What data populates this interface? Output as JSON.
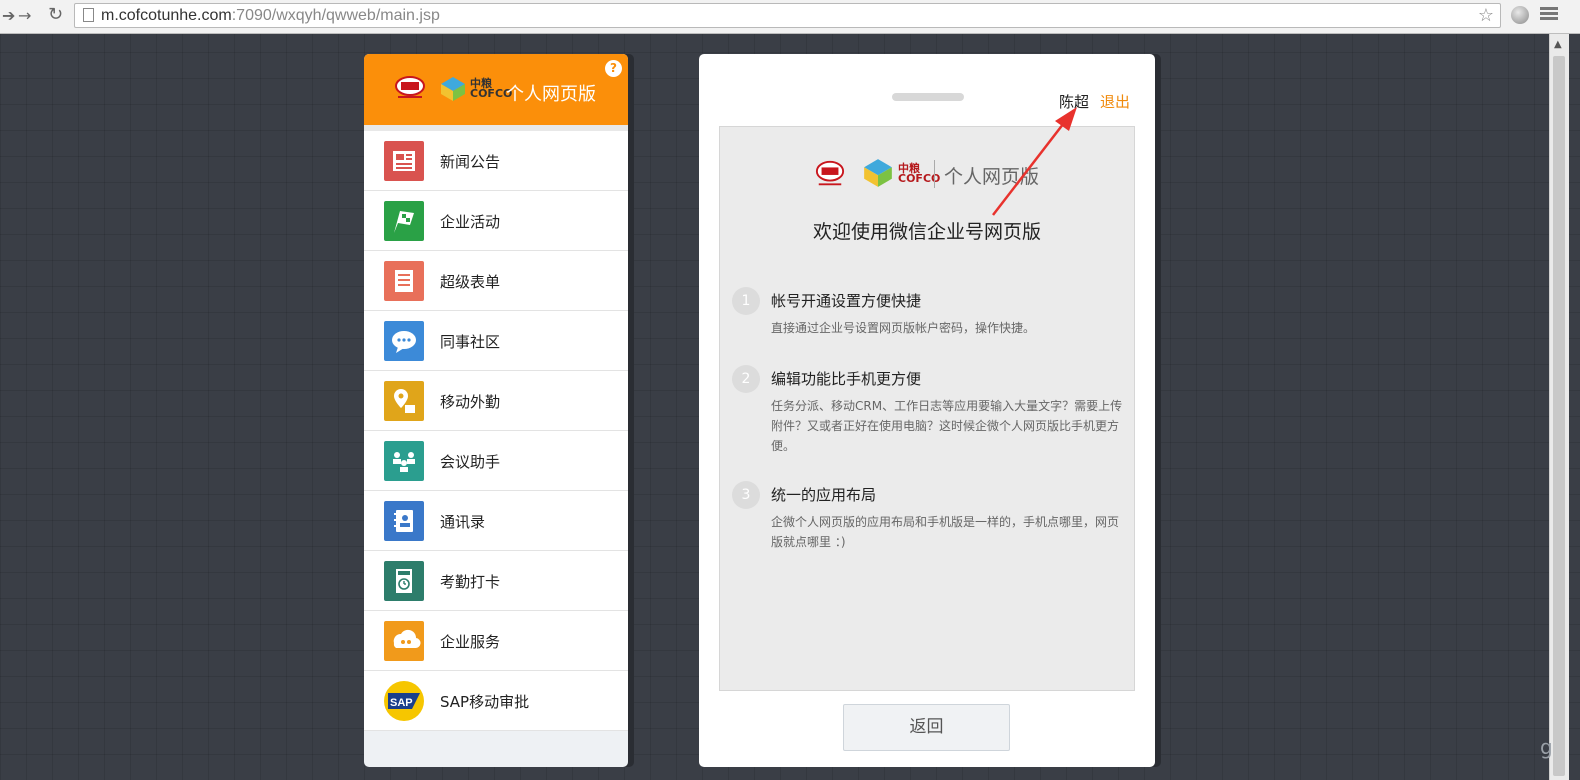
{
  "browser": {
    "url_host": "m.cofcotunhe.com",
    "url_path": ":7090/wxqyh/qwweb/main.jsp"
  },
  "left_panel": {
    "title": "个人网页版",
    "help": "?",
    "menu": [
      {
        "label": "新闻公告",
        "icon": "news-icon",
        "color": "#d9534f"
      },
      {
        "label": "企业活动",
        "icon": "flag-icon",
        "color": "#2aa146"
      },
      {
        "label": "超级表单",
        "icon": "form-icon",
        "color": "#e8705a"
      },
      {
        "label": "同事社区",
        "icon": "chat-icon",
        "color": "#3c8ad8"
      },
      {
        "label": "移动外勤",
        "icon": "location-icon",
        "color": "#e0a51a"
      },
      {
        "label": "会议助手",
        "icon": "meeting-icon",
        "color": "#2b9e8f"
      },
      {
        "label": "通讯录",
        "icon": "contacts-icon",
        "color": "#3a78c9"
      },
      {
        "label": "考勤打卡",
        "icon": "clock-icon",
        "color": "#2d7d6b"
      },
      {
        "label": "企业服务",
        "icon": "service-icon",
        "color": "#f19a1b"
      },
      {
        "label": "SAP移动审批",
        "icon": "sap-icon",
        "color": "#1a3f8c"
      }
    ]
  },
  "right_panel": {
    "user": "陈超",
    "logout": "退出",
    "brand": "个人网页版",
    "welcome": "欢迎使用微信企业号网页版",
    "steps": [
      {
        "num": "1",
        "title": "帐号开通设置方便快捷",
        "desc": "直接通过企业号设置网页版帐户密码，操作快捷。"
      },
      {
        "num": "2",
        "title": "编辑功能比手机更方便",
        "desc": "任务分派、移动CRM、工作日志等应用要输入大量文字？需要上传附件？又或者正好在使用电脑？这时候企微个人网页版比手机更方便。"
      },
      {
        "num": "3",
        "title": "统一的应用布局",
        "desc": "企微个人网页版的应用布局和手机版是一样的，手机点哪里，网页版就点哪里 ：)"
      }
    ],
    "back_button": "返回"
  },
  "colors": {
    "accent_orange": "#fb8f0a",
    "logout_orange": "#f08a0c",
    "annotation_red": "#e8322d"
  }
}
